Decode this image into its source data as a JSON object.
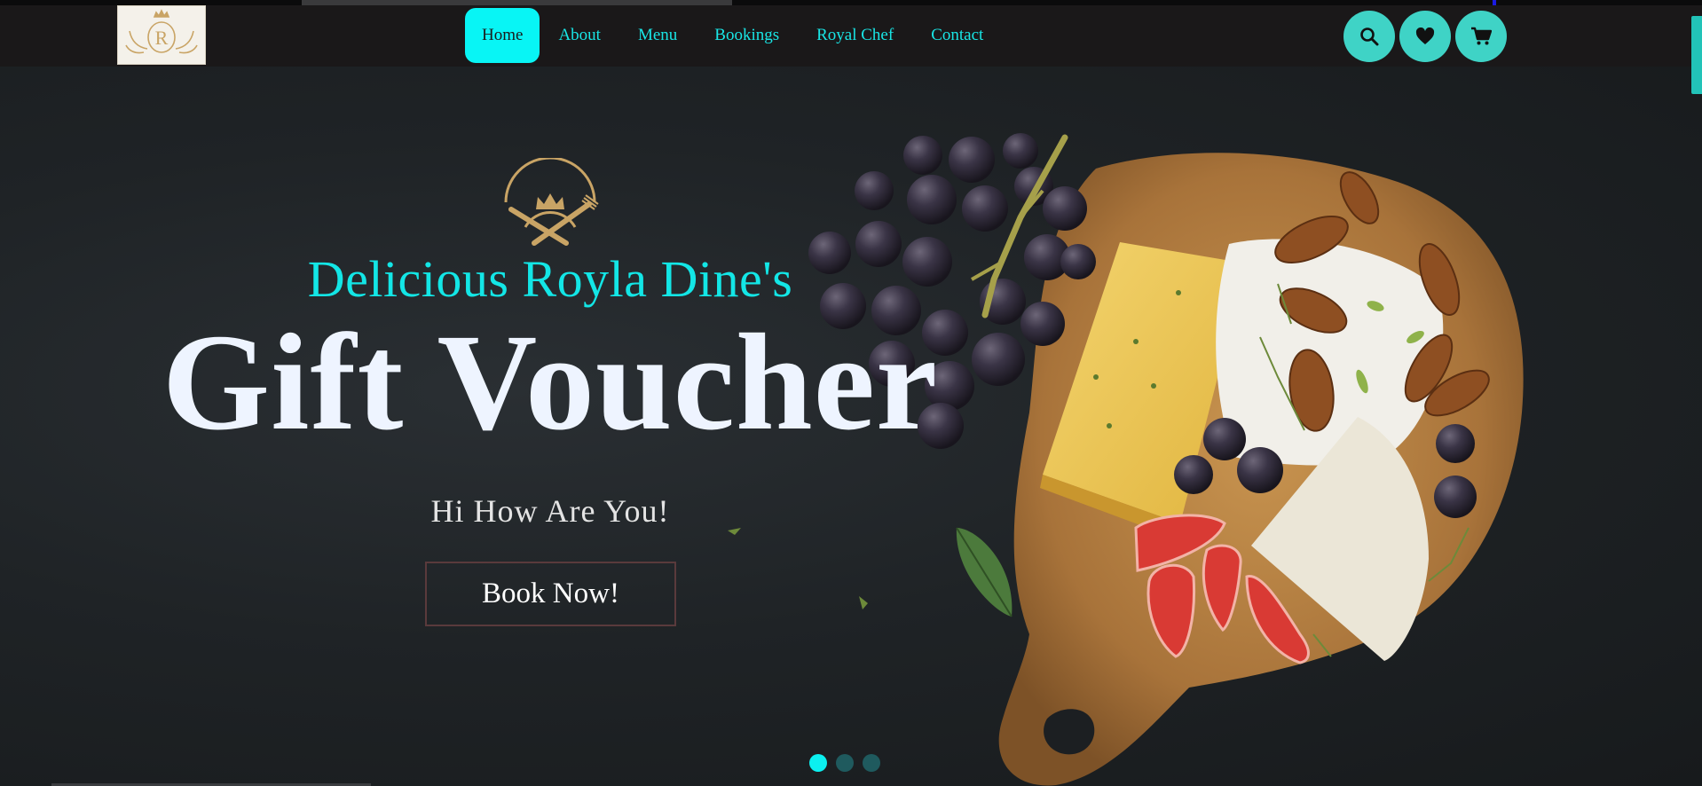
{
  "brand": {
    "logo_letter": "R"
  },
  "nav": {
    "items": [
      {
        "label": "Home",
        "active": true
      },
      {
        "label": "About",
        "active": false
      },
      {
        "label": "Menu",
        "active": false
      },
      {
        "label": "Bookings",
        "active": false
      },
      {
        "label": "Royal Chef",
        "active": false
      },
      {
        "label": "Contact",
        "active": false
      }
    ],
    "actions": [
      {
        "icon": "search-icon"
      },
      {
        "icon": "heart-icon"
      },
      {
        "icon": "cart-icon"
      }
    ]
  },
  "hero": {
    "subtitle": "Delicious Royla Dine's",
    "title": "Gift Voucher",
    "tagline": "Hi How Are You!",
    "cta_label": "Book Now!",
    "slides_total": 3,
    "active_slide": 1
  },
  "colors": {
    "accent": "#08f5f5",
    "nav_text": "#19e5e5",
    "icon_button": "#3fd3c6",
    "header_bg": "#1a1819",
    "gold": "#c9a465"
  }
}
